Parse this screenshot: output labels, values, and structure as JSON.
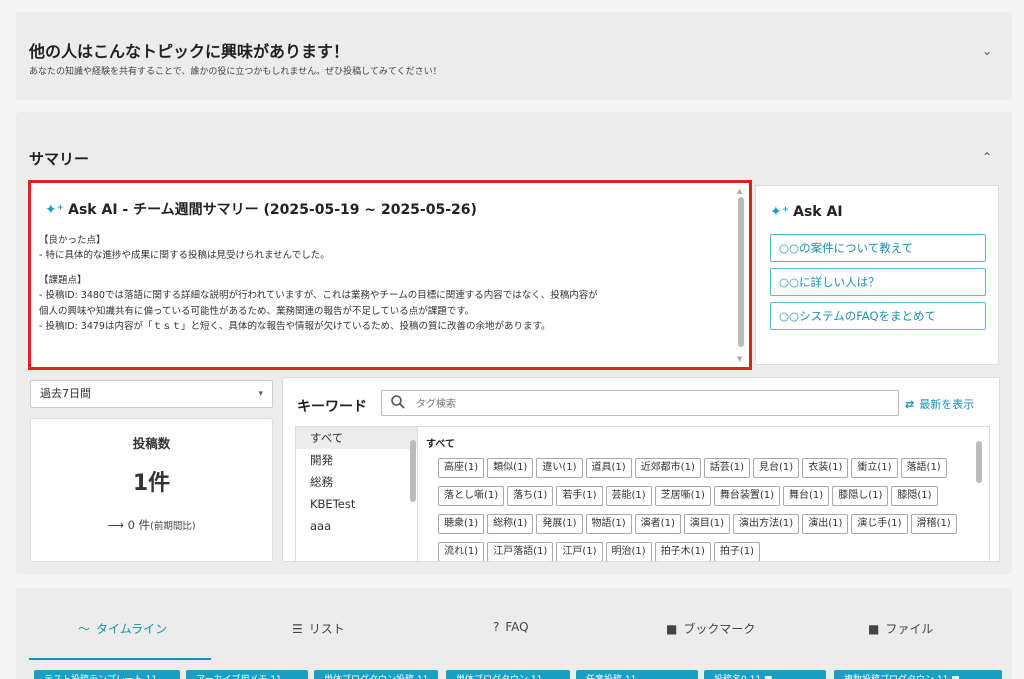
{
  "topic": {
    "title": "他の人はこんなトピックに興味があります！",
    "subtitle": "あなたの知識や経験を共有することで、誰かの役に立つかもしれません。ぜひ投稿してみてください！",
    "chevron": "⌄"
  },
  "summary": {
    "title": "サマリー",
    "chevron": "⌃",
    "ai_report": {
      "spark": "✦⁺",
      "title": "Ask AI - チーム週間サマリー (2025-05-19 ~ 2025-05-26)",
      "good_heading": "【良かった点】",
      "good_line1": "- 特に具体的な進捗や成果に関する投稿は見受けられませんでした。",
      "issue_heading": "【課題点】",
      "issue_line1": "- 投稿ID: 3480では落語に関する詳細な説明が行われていますが、これは業務やチームの目標に関連する内容ではなく、投稿内容が",
      "issue_line2": "個人の興味や知識共有に偏っている可能性があるため、業務関連の報告が不足している点が課題です。",
      "issue_line3": "- 投稿ID: 3479は内容が「ｔｓｔ」と短く、具体的な報告や情報が欠けているため、投稿の質に改善の余地があります。"
    },
    "askai": {
      "spark": "✦⁺",
      "title": "Ask AI",
      "buttons": [
        "○○の案件について教えて",
        "○○に詳しい人は？",
        "○○システムのFAQをまとめて"
      ]
    },
    "period": {
      "selected": "過去7日間",
      "caret": "▾"
    },
    "posts": {
      "label": "投稿数",
      "value": "1件",
      "arrow": "⟶",
      "diff": "0 件",
      "diff_note": "(前期間比)"
    },
    "keywords": {
      "label": "キーワード",
      "search_placeholder": "タグ検索",
      "refresh_icon": "⇄",
      "refresh_label": "最新を表示",
      "categories": [
        "すべて",
        "開発",
        "総務",
        "KBETest",
        "aaa"
      ],
      "selected_category": "すべて",
      "tags_heading": "すべて",
      "tags": [
        "高座(1)",
        "類似(1)",
        "違い(1)",
        "道具(1)",
        "近郊都市(1)",
        "話芸(1)",
        "見台(1)",
        "衣装(1)",
        "衝立(1)",
        "落語(1)",
        "落とし噺(1)",
        "落ち(1)",
        "若手(1)",
        "芸能(1)",
        "芝居噺(1)",
        "舞台装置(1)",
        "舞台(1)",
        "膝隠し(1)",
        "膝隠(1)",
        "聴衆(1)",
        "総称(1)",
        "発展(1)",
        "物語(1)",
        "演者(1)",
        "演目(1)",
        "演出方法(1)",
        "演出(1)",
        "演じ手(1)",
        "滑稽(1)",
        "流れ(1)",
        "江戸落語(1)",
        "江戸(1)",
        "明治(1)",
        "拍子木(1)",
        "拍子(1)"
      ]
    }
  },
  "nav": {
    "tabs": [
      {
        "icon": "〜",
        "label": "タイムライン"
      },
      {
        "icon": "☰",
        "label": "リスト"
      },
      {
        "icon": "?",
        "label": "FAQ"
      },
      {
        "icon": "■",
        "label": "ブックマーク"
      },
      {
        "icon": "■",
        "label": "ファイル"
      }
    ],
    "chips": [
      "テスト投稿テンプレート 11",
      "アーカイブ用メモ 11",
      "単体ブログタウン投稿 11",
      "単体ブログタウン 11",
      "任意投稿 11",
      "投稿名0 11 ■",
      "複数投稿ブログタウン 11 ■"
    ]
  },
  "colors": {
    "accent": "#1a9fc4",
    "highlight_border": "#e0221b"
  }
}
